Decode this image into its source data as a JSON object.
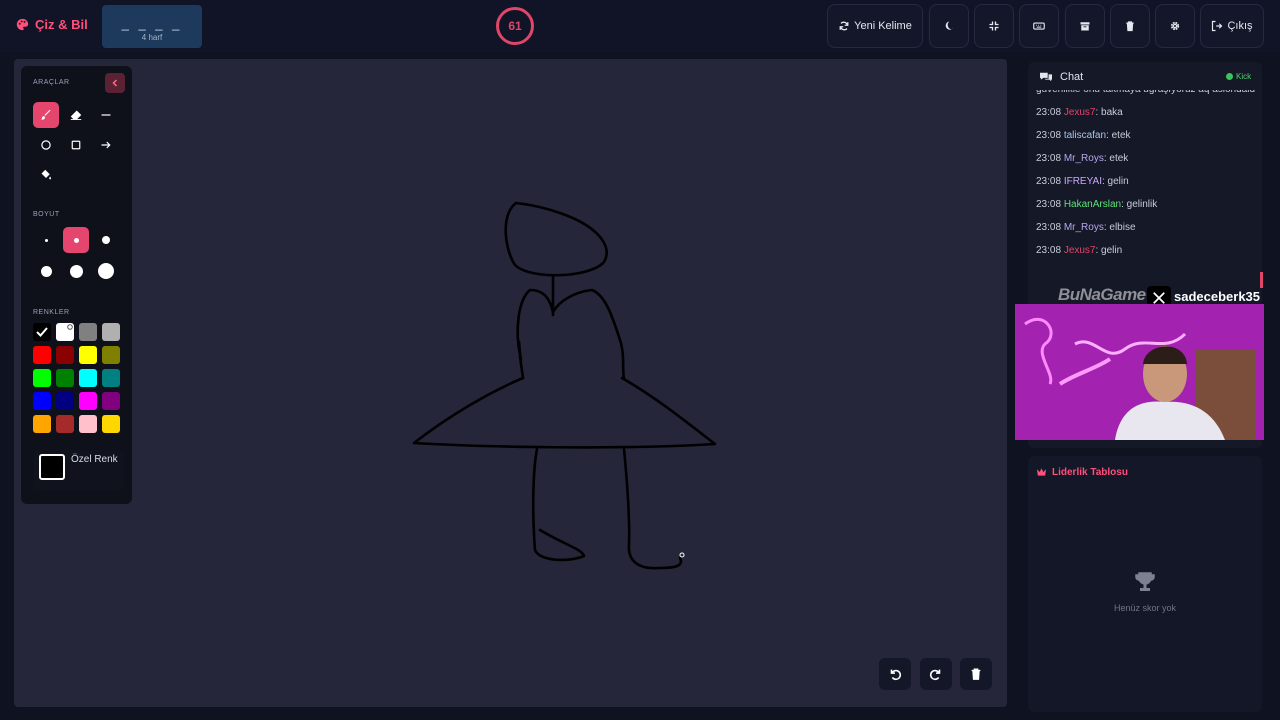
{
  "app": {
    "title": "Çiz & Bil"
  },
  "word": {
    "mask": "_ _ _ _",
    "hint": "4 harf"
  },
  "timer": {
    "seconds": "61"
  },
  "toolbar": {
    "new_word_label": "Yeni Kelime",
    "exit_label": "Çıkış"
  },
  "tools": {
    "title": "ARAÇLAR",
    "size_title": "BOYUT",
    "colors_title": "RENKLER",
    "custom_color_label": "Özel Renk",
    "colors": [
      "#000000",
      "#ffffff",
      "#808080",
      "#b0b0b0",
      "#ff0000",
      "#8b0000",
      "#ffff00",
      "#808000",
      "#00ff00",
      "#008000",
      "#00ffff",
      "#008080",
      "#0000ff",
      "#000080",
      "#ff00ff",
      "#800080",
      "#ffa500",
      "#a52a2a",
      "#ffc0cb",
      "#ffd700"
    ],
    "selected_color": "#000000",
    "selected_tool": "brush",
    "selected_size": 2
  },
  "chat": {
    "title": "Chat",
    "platform": "Kick",
    "truncated_text": "güvenlikle onu takmaya uğraşıyoruz aq aslohdald",
    "messages": [
      {
        "time": "23:08",
        "user": "Jexus7",
        "text": ": baka",
        "color": "#e0456a"
      },
      {
        "time": "23:08",
        "user": "taliscafan",
        "text": ": etek",
        "color": "#a9c7e8"
      },
      {
        "time": "23:08",
        "user": "Mr_Roys",
        "text": ": etek",
        "color": "#b6a8ea"
      },
      {
        "time": "23:08",
        "user": "IFREYAI",
        "text": ": gelin",
        "color": "#c9a8ff"
      },
      {
        "time": "23:08",
        "user": "HakanArslan",
        "text": ": gelinlik",
        "color": "#5fe07a"
      },
      {
        "time": "23:08",
        "user": "Mr_Roys",
        "text": ": elbise",
        "color": "#b6a8ea"
      },
      {
        "time": "23:08",
        "user": "Jexus7",
        "text": ": gelin",
        "color": "#e0456a"
      }
    ]
  },
  "overlay": {
    "logo": "BuNaGame",
    "handle": "sadeceberk35"
  },
  "leaderboard": {
    "title": "Liderlik Tablosu",
    "empty_text": "Henüz skor yok"
  }
}
